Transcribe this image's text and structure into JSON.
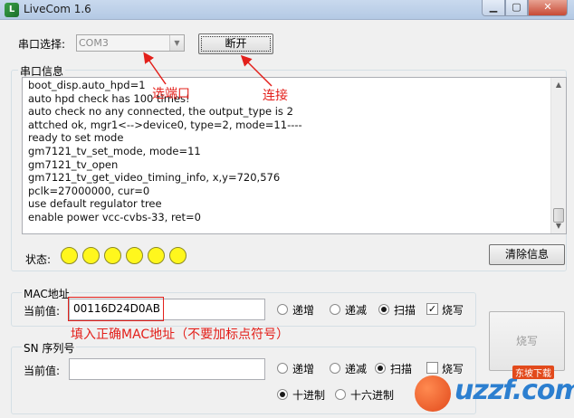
{
  "window": {
    "title": "LiveCom 1.6",
    "icon": "app-icon",
    "controls": {
      "minimize": "minimize-icon",
      "maximize": "maximize-icon",
      "close": "close-icon"
    }
  },
  "port": {
    "label": "串口选择:",
    "selected": "COM3",
    "connect_label": "断开"
  },
  "serial": {
    "title": "串口信息",
    "log": [
      "boot_disp.auto_hpd=1",
      "auto hpd check has 100 times!",
      "auto check no any connected, the output_type is 2",
      "attched ok, mgr1<-->device0, type=2, mode=11----",
      "ready to set mode",
      "gm7121_tv_set_mode, mode=11",
      "gm7121_tv_open",
      "gm7121_tv_get_video_timing_info, x,y=720,576",
      "pclk=27000000, cur=0",
      "use default regulator tree",
      "enable power vcc-cvbs-33, ret=0"
    ]
  },
  "status": {
    "label": "状态:",
    "leds": 6,
    "led_color": "#fff71d",
    "clear_label": "清除信息"
  },
  "mac": {
    "title": "MAC地址",
    "current_label": "当前值:",
    "value": "00116D24D0AB",
    "options": [
      "递增",
      "递减",
      "扫描"
    ],
    "selected_option": "扫描",
    "burn_check_label": "烧写",
    "burn_checked": true
  },
  "sn": {
    "title": "SN 序列号",
    "current_label": "当前值:",
    "value": "",
    "options": [
      "递增",
      "递减",
      "扫描"
    ],
    "selected_option": "扫描",
    "burn_check_label": "烧写",
    "base_options": [
      "十进制",
      "十六进制"
    ],
    "selected_base": "十进制"
  },
  "burn_button_label": "烧写",
  "annotations": {
    "select_port": "选端口",
    "connect": "连接",
    "mac_hint": "填入正确MAC地址（不要加标点符号）",
    "color": "#e3201b"
  },
  "watermark": {
    "text": "uzzf.com",
    "tag": "东坡下载"
  }
}
